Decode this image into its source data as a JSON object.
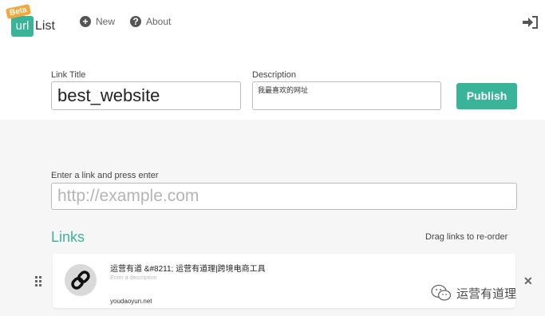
{
  "brand": {
    "badge": "Beta",
    "url_part": "url",
    "list_part": "List"
  },
  "nav": {
    "new_label": "New",
    "about_label": "About"
  },
  "form": {
    "title_label": "Link Title",
    "title_value": "best_website",
    "description_label": "Description",
    "description_value": "我最喜欢的网址",
    "publish_label": "Publish"
  },
  "link_entry": {
    "label": "Enter a link and press enter",
    "placeholder": "http://example.com"
  },
  "links": {
    "heading": "Links",
    "drag_hint": "Drag links to re-order",
    "items": [
      {
        "title": "运营有道 &#8211; 运营有道理|跨境电商工具",
        "description_placeholder": "Enter a description",
        "url": "youdaoyun.net"
      }
    ]
  },
  "watermark": {
    "text": "运营有道理"
  },
  "colors": {
    "accent": "#3ab499",
    "badge": "#f3a83b"
  },
  "icons": [
    "plus-circle-icon",
    "question-circle-icon",
    "sign-in-icon",
    "link-icon",
    "drag-handle-icon",
    "close-icon",
    "wechat-icon"
  ]
}
